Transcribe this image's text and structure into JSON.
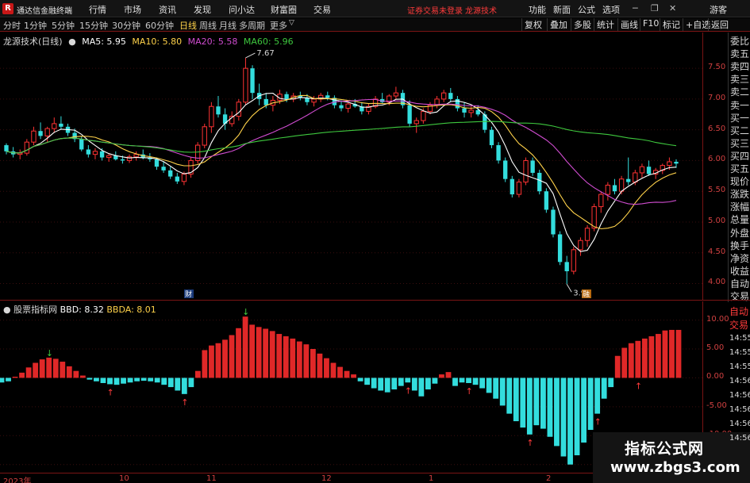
{
  "app": {
    "logo": "R",
    "title": "通达信金融终端"
  },
  "menu": [
    "行情",
    "市场",
    "资讯",
    "发现",
    "问小达",
    "财富圈",
    "交易"
  ],
  "status": {
    "message": "证券交易未登录",
    "brand": "龙源技术"
  },
  "right_menu": [
    "功能",
    "新面",
    "公式",
    "选项"
  ],
  "account_label": "游客",
  "periods": [
    "分时",
    "1分钟",
    "5分钟",
    "15分钟",
    "30分钟",
    "60分钟",
    "日线",
    "周线",
    "月线",
    "多周期",
    "更多"
  ],
  "active_period": "日线",
  "right_tools": [
    "复权",
    "叠加",
    "多股",
    "统计",
    "画线",
    "F10",
    "标记",
    "+自选",
    "返回"
  ],
  "colors": {
    "up": "#ff3333",
    "down": "#33dddd",
    "ma5": "#ffffff",
    "ma10": "#ffd24a",
    "ma20": "#d04cd0",
    "ma60": "#3ec83e",
    "axis": "#d04040",
    "bbd": "#ffffff",
    "bbda": "#ffd24a"
  },
  "main_legend": {
    "title": "龙源技术(日线)",
    "ma5": "MA5: 5.95",
    "ma10": "MA10: 5.80",
    "ma20": "MA20: 5.58",
    "ma60": "MA60: 5.96"
  },
  "price_ticks": [
    "7.50",
    "7.00",
    "6.50",
    "6.00",
    "5.50",
    "5.00",
    "4.50",
    "4.00"
  ],
  "price_annotations": {
    "high": "7.67",
    "low": "3.99",
    "badge_left": "财",
    "badge_right": "融"
  },
  "info_column": [
    "委比",
    "卖五",
    "卖四",
    "卖三",
    "卖二",
    "卖一",
    "买一",
    "买二",
    "买三",
    "买四",
    "买五",
    "现价",
    "涨跌",
    "涨幅",
    "总量",
    "外盘",
    "换手",
    "净资",
    "收益",
    "自动",
    "交易"
  ],
  "indicator_legend": {
    "title": "股票指标网",
    "bbd": "BBD: 8.32",
    "bbda": "BBDA: 8.01"
  },
  "indicator_ticks": [
    "10.00",
    "5.00",
    "0.00",
    "-5.00",
    "-10.00",
    "-15.00"
  ],
  "indicator_time_col": [
    "14:55",
    "14:55",
    "14:55",
    "14:56",
    "14:56",
    "14:56",
    "14:56",
    "14:56"
  ],
  "time_ticks": [
    "2023年",
    "10",
    "11",
    "12",
    "1",
    "2"
  ],
  "watermark": {
    "title": "指标公式网",
    "url": "www.zbgs3.com"
  },
  "chart_data": [
    {
      "type": "candlestick",
      "title": "龙源技术(日线)",
      "ylim": [
        3.8,
        7.85
      ],
      "x": [
        "2023年",
        "10",
        "11",
        "12",
        "1",
        "2"
      ],
      "candles": [
        [
          6.25,
          6.28,
          6.1,
          6.15
        ],
        [
          6.15,
          6.22,
          6.05,
          6.1
        ],
        [
          6.1,
          6.18,
          6.02,
          6.12
        ],
        [
          6.12,
          6.35,
          6.08,
          6.3
        ],
        [
          6.3,
          6.55,
          6.25,
          6.48
        ],
        [
          6.48,
          6.62,
          6.35,
          6.4
        ],
        [
          6.4,
          6.55,
          6.3,
          6.52
        ],
        [
          6.52,
          6.7,
          6.45,
          6.6
        ],
        [
          6.6,
          6.72,
          6.5,
          6.55
        ],
        [
          6.55,
          6.6,
          6.4,
          6.45
        ],
        [
          6.45,
          6.52,
          6.3,
          6.35
        ],
        [
          6.35,
          6.4,
          6.15,
          6.18
        ],
        [
          6.18,
          6.25,
          6.05,
          6.1
        ],
        [
          6.1,
          6.2,
          6.02,
          6.15
        ],
        [
          6.15,
          6.2,
          6.0,
          6.05
        ],
        [
          6.05,
          6.12,
          5.98,
          6.08
        ],
        [
          6.08,
          6.15,
          6.0,
          6.02
        ],
        [
          6.02,
          6.08,
          5.95,
          6.0
        ],
        [
          6.0,
          6.1,
          5.96,
          6.06
        ],
        [
          6.06,
          6.15,
          6.0,
          6.1
        ],
        [
          6.1,
          6.18,
          6.02,
          6.05
        ],
        [
          6.05,
          6.12,
          5.98,
          6.02
        ],
        [
          6.02,
          6.05,
          5.85,
          5.9
        ],
        [
          5.9,
          5.98,
          5.8,
          5.84
        ],
        [
          5.84,
          5.9,
          5.7,
          5.74
        ],
        [
          5.74,
          5.8,
          5.62,
          5.66
        ],
        [
          5.66,
          5.82,
          5.6,
          5.78
        ],
        [
          5.78,
          6.05,
          5.72,
          6.0
        ],
        [
          6.0,
          6.3,
          5.95,
          6.25
        ],
        [
          6.25,
          6.6,
          6.2,
          6.55
        ],
        [
          6.55,
          6.95,
          6.45,
          6.88
        ],
        [
          6.88,
          7.05,
          6.7,
          6.75
        ],
        [
          6.75,
          6.85,
          6.5,
          6.6
        ],
        [
          6.6,
          6.8,
          6.55,
          6.72
        ],
        [
          6.72,
          7.0,
          6.65,
          6.95
        ],
        [
          6.95,
          7.67,
          6.9,
          7.5
        ],
        [
          7.5,
          7.55,
          7.0,
          7.1
        ],
        [
          7.1,
          7.25,
          6.9,
          7.0
        ],
        [
          7.0,
          7.1,
          6.85,
          6.9
        ],
        [
          6.9,
          7.05,
          6.8,
          6.98
        ],
        [
          6.98,
          7.15,
          6.92,
          7.08
        ],
        [
          7.08,
          7.12,
          6.95,
          7.0
        ],
        [
          7.0,
          7.1,
          6.95,
          7.05
        ],
        [
          7.05,
          7.12,
          6.98,
          7.02
        ],
        [
          7.02,
          7.08,
          6.9,
          6.95
        ],
        [
          6.95,
          7.05,
          6.88,
          7.0
        ],
        [
          7.0,
          7.1,
          6.95,
          7.06
        ],
        [
          7.06,
          7.12,
          6.98,
          7.02
        ],
        [
          7.02,
          7.06,
          6.85,
          6.9
        ],
        [
          6.9,
          6.98,
          6.8,
          6.85
        ],
        [
          6.85,
          6.95,
          6.78,
          6.92
        ],
        [
          6.92,
          7.0,
          6.86,
          6.88
        ],
        [
          6.88,
          6.95,
          6.75,
          6.8
        ],
        [
          6.8,
          6.92,
          6.75,
          6.88
        ],
        [
          6.88,
          7.05,
          6.85,
          7.0
        ],
        [
          7.0,
          7.1,
          6.92,
          6.95
        ],
        [
          6.95,
          7.08,
          6.9,
          7.05
        ],
        [
          7.05,
          7.2,
          7.0,
          7.1
        ],
        [
          7.1,
          7.15,
          6.85,
          6.9
        ],
        [
          6.9,
          6.98,
          6.55,
          6.6
        ],
        [
          6.6,
          6.7,
          6.45,
          6.65
        ],
        [
          6.65,
          6.85,
          6.6,
          6.8
        ],
        [
          6.8,
          6.95,
          6.75,
          6.9
        ],
        [
          6.9,
          7.05,
          6.85,
          7.0
        ],
        [
          7.0,
          7.15,
          6.95,
          7.1
        ],
        [
          7.1,
          7.18,
          6.95,
          7.0
        ],
        [
          7.0,
          7.05,
          6.8,
          6.85
        ],
        [
          6.85,
          6.95,
          6.7,
          6.78
        ],
        [
          6.78,
          6.88,
          6.7,
          6.82
        ],
        [
          6.82,
          6.9,
          6.72,
          6.75
        ],
        [
          6.75,
          6.8,
          6.45,
          6.5
        ],
        [
          6.5,
          6.55,
          6.2,
          6.25
        ],
        [
          6.25,
          6.3,
          5.95,
          6.0
        ],
        [
          6.0,
          6.05,
          5.65,
          5.7
        ],
        [
          5.7,
          5.75,
          5.4,
          5.45
        ],
        [
          5.45,
          5.7,
          5.4,
          5.65
        ],
        [
          5.65,
          6.05,
          5.6,
          6.0
        ],
        [
          6.0,
          6.05,
          5.75,
          5.8
        ],
        [
          5.8,
          5.85,
          5.45,
          5.5
        ],
        [
          5.5,
          5.55,
          5.15,
          5.2
        ],
        [
          5.2,
          5.25,
          4.75,
          4.8
        ],
        [
          4.8,
          4.85,
          4.3,
          4.35
        ],
        [
          4.35,
          4.45,
          3.99,
          4.2
        ],
        [
          4.2,
          4.6,
          4.15,
          4.55
        ],
        [
          4.55,
          4.75,
          4.45,
          4.7
        ],
        [
          4.7,
          4.95,
          4.6,
          4.9
        ],
        [
          4.9,
          5.3,
          4.85,
          5.25
        ],
        [
          5.25,
          5.5,
          5.15,
          5.45
        ],
        [
          5.45,
          5.65,
          5.35,
          5.6
        ],
        [
          5.6,
          5.7,
          5.45,
          5.5
        ],
        [
          5.5,
          5.75,
          5.45,
          5.7
        ],
        [
          5.7,
          6.05,
          5.6,
          5.65
        ],
        [
          5.65,
          5.85,
          5.6,
          5.8
        ],
        [
          5.8,
          5.95,
          5.72,
          5.9
        ],
        [
          5.9,
          6.0,
          5.75,
          5.78
        ],
        [
          5.78,
          5.88,
          5.7,
          5.84
        ],
        [
          5.84,
          5.95,
          5.78,
          5.92
        ],
        [
          5.92,
          6.05,
          5.85,
          5.98
        ],
        [
          5.98,
          6.02,
          5.88,
          5.95
        ]
      ]
    },
    {
      "type": "bar",
      "title": "股票指标网",
      "ylim": [
        -16,
        12
      ],
      "series": [
        {
          "name": "BBD",
          "values": [
            -0.8,
            -0.6,
            0.2,
            0.9,
            1.8,
            2.6,
            3.2,
            3.5,
            3.3,
            2.8,
            2.0,
            1.2,
            0.4,
            -0.3,
            -0.6,
            -0.9,
            -1.1,
            -1.2,
            -1.0,
            -0.8,
            -0.6,
            -0.5,
            -0.6,
            -0.8,
            -1.2,
            -1.6,
            -2.2,
            -2.8,
            -1.6,
            1.2,
            4.8,
            5.6,
            6.0,
            6.6,
            7.4,
            8.6,
            10.6,
            9.2,
            8.8,
            8.5,
            8.1,
            7.6,
            7.2,
            6.8,
            6.3,
            5.8,
            5.0,
            4.2,
            3.4,
            2.6,
            1.9,
            1.2,
            0.6,
            -0.6,
            -1.2,
            -1.8,
            -2.2,
            -2.5,
            -2.0,
            -1.4,
            -0.8,
            -2.2,
            -3.2,
            -2.0,
            -1.0,
            0.6,
            1.0,
            -1.4,
            -0.8,
            -0.9,
            -1.2,
            -1.8,
            -2.6,
            -3.6,
            -4.8,
            -6.2,
            -7.5,
            -8.6,
            -9.8,
            -8.2,
            -8.8,
            -10.2,
            -11.8,
            -13.6,
            -15.0,
            -13.4,
            -11.2,
            -9.0,
            -6.2,
            -3.6,
            -1.6,
            3.8,
            5.2,
            6.0,
            6.4,
            6.8,
            7.2,
            7.6,
            8.2,
            8.3,
            8.3
          ]
        }
      ]
    }
  ]
}
